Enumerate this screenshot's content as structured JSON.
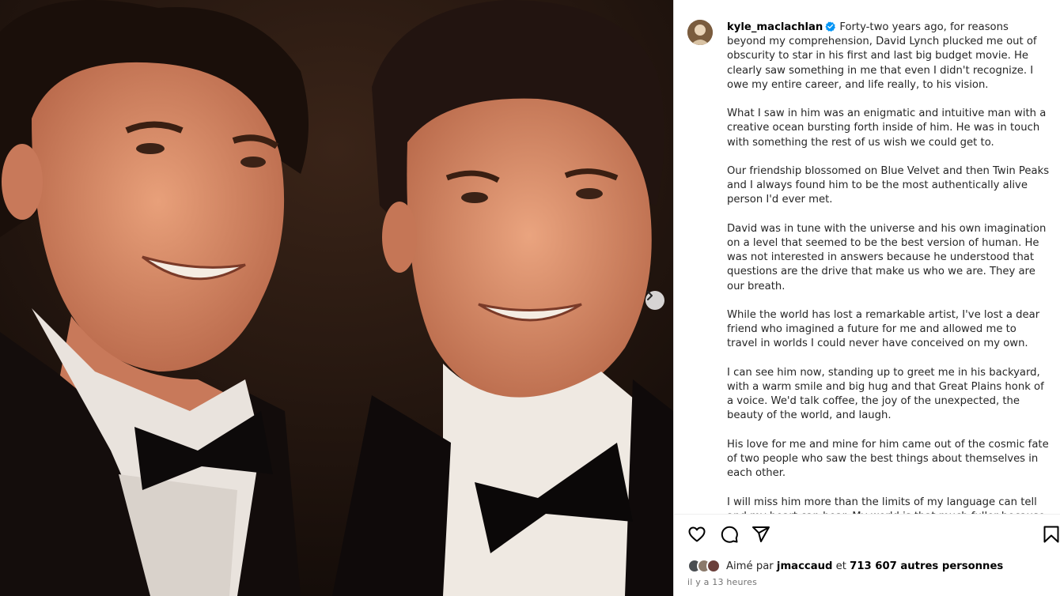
{
  "post": {
    "username": "kyle_maclachlan",
    "caption_first": "Forty-two years ago, for reasons beyond my comprehension, David Lynch plucked me out of obscurity to star in his first and last big budget movie. He clearly saw something in me that even I didn't recognize. I owe my entire career, and life really, to his vision.",
    "paragraphs": [
      "What I saw in him was an enigmatic and intuitive man with a creative ocean bursting forth inside of him. He was in touch with something the rest of us wish we could get to.",
      "Our friendship blossomed on Blue Velvet and then Twin Peaks and I always found him to be the most authentically alive person I'd ever met.",
      "David was in tune with the universe and his own imagination on a level that seemed to be the best version of human. He was not interested in answers because he understood that questions are the drive that make us who we are. They are our breath.",
      "While the world has lost a remarkable artist, I've lost a dear friend who imagined a future for me and allowed me to travel in worlds I could never have conceived on my own.",
      "I can see him now, standing up to greet me in his backyard, with a warm smile and big hug and that Great Plains honk of a voice. We'd talk coffee, the joy of the unexpected, the beauty of the world, and laugh.",
      "His love for me and mine for him came out of the cosmic fate of two people who saw the best things about themselves in each other.",
      "I will miss him more than the limits of my language can tell and my heart can bear. My world is that much fuller because I knew him and that much emptier now that he's gone."
    ]
  },
  "likes": {
    "prefix": "Aimé par",
    "liker": "jmaccaud",
    "connector": "et",
    "others": "713 607 autres personnes"
  },
  "timestamp": "il y a 13 heures",
  "icons": {
    "like": "heart-icon",
    "comment": "comment-icon",
    "share": "share-icon",
    "save": "bookmark-icon",
    "next": "chevron-right-icon",
    "verified": "verified-badge-icon"
  },
  "colors": {
    "verified": "#0095f6",
    "secondary_text": "#737373",
    "photo_background": "#1c120d"
  }
}
